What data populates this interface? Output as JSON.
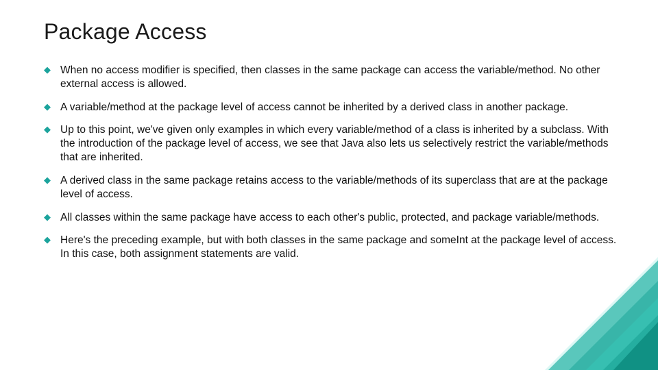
{
  "title": "Package Access",
  "bullets": [
    "When no access modifier is specified, then classes in the same package can access the variable/method. No other external access is allowed.",
    "A variable/method at the package level of access cannot be inherited by a derived class in another package.",
    "Up to this point, we've given only examples in which every variable/method of a class is inherited by a subclass. With the introduction of the package level of access, we see that Java also lets us selectively restrict the variable/methods that are inherited.",
    "A derived class in the same package retains access to the variable/methods of its superclass that are at the package level of access.",
    "All classes within the same package have access to each other's public, protected, and package variable/methods.",
    "Here's the preceding example, but with both classes in the same package and someInt at the package level of access. In this case, both assignment statements are valid."
  ]
}
